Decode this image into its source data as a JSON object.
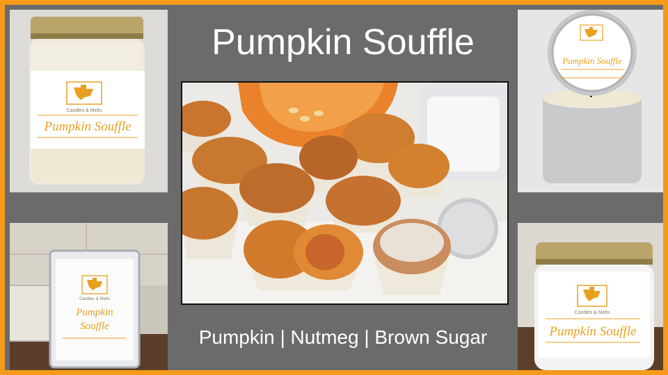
{
  "title": "Pumpkin Souffle",
  "scent_notes": "Pumpkin | Nutmeg | Brown Sugar",
  "label": {
    "brand": "Candles & Melts",
    "product": "Pumpkin Souffle",
    "product_line1": "Pumpkin",
    "product_line2": "Souffle"
  },
  "colors": {
    "border": "#f59a1b",
    "background": "#6b6b6b",
    "text": "#ffffff",
    "label_accent": "#e8a020"
  }
}
